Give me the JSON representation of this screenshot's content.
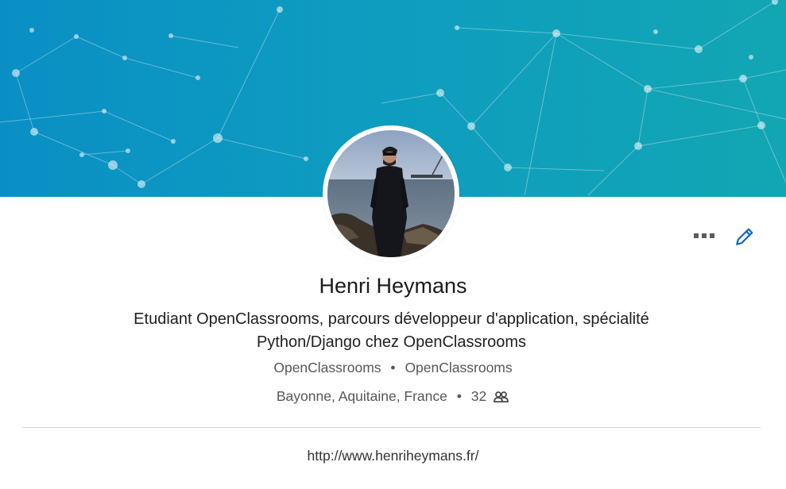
{
  "profile": {
    "name": "Henri Heymans",
    "headline": "Etudiant OpenClassrooms, parcours développeur d'application, spécialité Python/Django chez OpenClassrooms",
    "current_company": "OpenClassrooms",
    "education": "OpenClassrooms",
    "separator": "•",
    "location": "Bayonne, Aquitaine, France",
    "connections": "32",
    "website": "http://www.henriheymans.fr/"
  },
  "icons": {
    "more": "more-dots-icon",
    "edit": "pencil-icon",
    "connections": "people-icon"
  },
  "colors": {
    "banner_start": "#0a8fc4",
    "banner_end": "#12a6b3",
    "edit_icon": "#0a66c2",
    "muted_text": "#575757"
  }
}
